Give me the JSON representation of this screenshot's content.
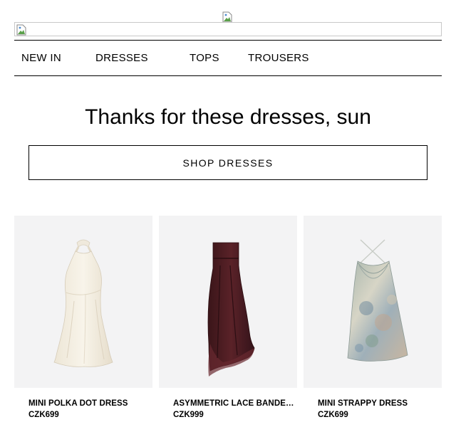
{
  "header": {
    "logo_icon": "broken-image-icon",
    "banner_icon": "broken-image-icon"
  },
  "nav": {
    "items": [
      {
        "label": "NEW IN"
      },
      {
        "label": "DRESSES"
      },
      {
        "label": "TOPS"
      },
      {
        "label": "TROUSERS"
      }
    ]
  },
  "hero": {
    "headline": "Thanks for these dresses, sun",
    "cta_label": "SHOP DRESSES"
  },
  "products": [
    {
      "name": "MINI POLKA DOT DRESS",
      "price": "CZK699",
      "image": "white-halter-mini-dress"
    },
    {
      "name": "ASYMMETRIC LACE BANDEA...",
      "price": "CZK999",
      "image": "burgundy-strapless-asymmetric-dress"
    },
    {
      "name": "MINI STRAPPY DRESS",
      "price": "CZK699",
      "image": "watercolor-print-cowl-neck-dress"
    }
  ],
  "colors": {
    "text": "#000000",
    "product_bg": "#f3f3f4",
    "border": "#000000"
  }
}
